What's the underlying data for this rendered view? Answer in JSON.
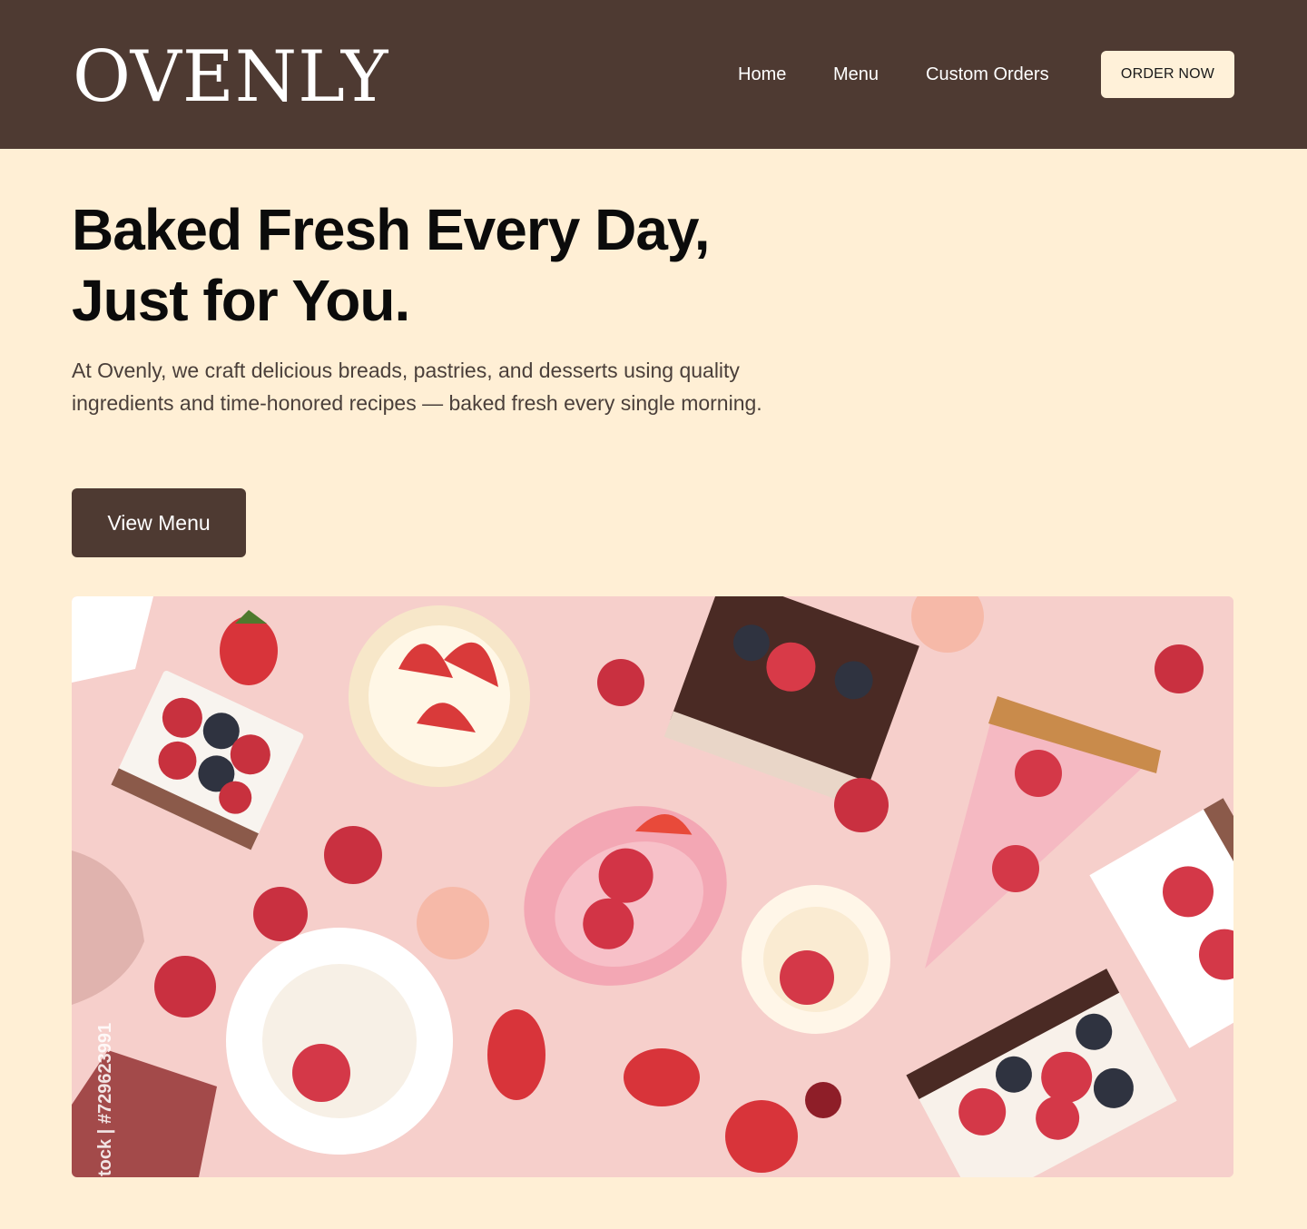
{
  "header": {
    "logo": "OVENLY",
    "nav": [
      {
        "label": "Home"
      },
      {
        "label": "Menu"
      },
      {
        "label": "Custom Orders"
      }
    ],
    "cta_label": "ORDER NOW"
  },
  "hero": {
    "title_line1": "Baked Fresh Every Day,",
    "title_line2": "Just for You.",
    "description": "At Ovenly, we craft delicious breads, pastries, and desserts using quality ingredients and time-honored recipes — baked fresh every single morning.",
    "button_label": "View Menu",
    "image_watermark": "tock | #729623991"
  },
  "colors": {
    "header_bg": "#4E3A32",
    "page_bg": "#FFEFD5",
    "cta_bg": "#FFF1D9",
    "button_bg": "#4E3A32",
    "image_bg": "#F6CFCB"
  }
}
